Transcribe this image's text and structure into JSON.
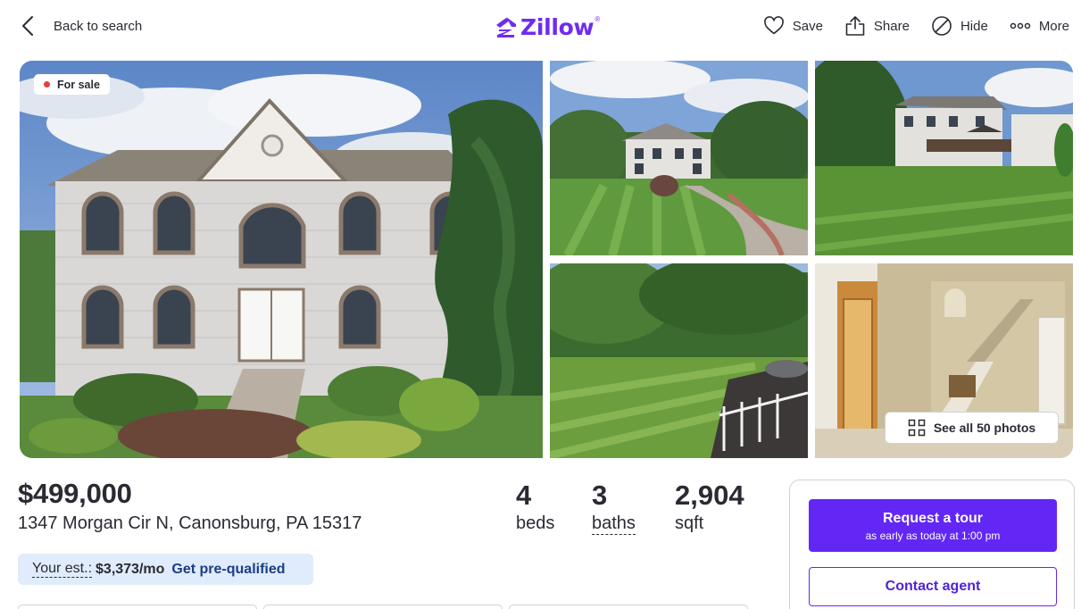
{
  "header": {
    "back_label": "Back to search",
    "logo_text": "Zillow",
    "logo_mark": "®",
    "actions": [
      {
        "label": "Save",
        "icon": "heart-icon"
      },
      {
        "label": "Share",
        "icon": "share-icon"
      },
      {
        "label": "Hide",
        "icon": "hide-icon"
      },
      {
        "label": "More",
        "icon": "more-icon"
      }
    ]
  },
  "gallery": {
    "status_badge": "For sale",
    "see_all_label": "See all 50 photos"
  },
  "listing": {
    "price": "$499,000",
    "address": "1347 Morgan Cir N, Canonsburg, PA 15317",
    "facts": [
      {
        "value": "4",
        "label": "beds"
      },
      {
        "value": "3",
        "label": "baths"
      },
      {
        "value": "2,904",
        "label": "sqft"
      }
    ],
    "estimate": {
      "label": "Your est.:",
      "value": "$3,373/mo",
      "link": "Get pre-qualified"
    }
  },
  "contact_card": {
    "tour_button": "Request a tour",
    "tour_subtext": "as early as today at 1:00 pm",
    "contact_button": "Contact agent"
  },
  "colors": {
    "brand": "#6f2cf0",
    "primary_button": "#6227f5",
    "estimate_bg": "#e0ecfb",
    "status_dot": "#e3413e"
  }
}
